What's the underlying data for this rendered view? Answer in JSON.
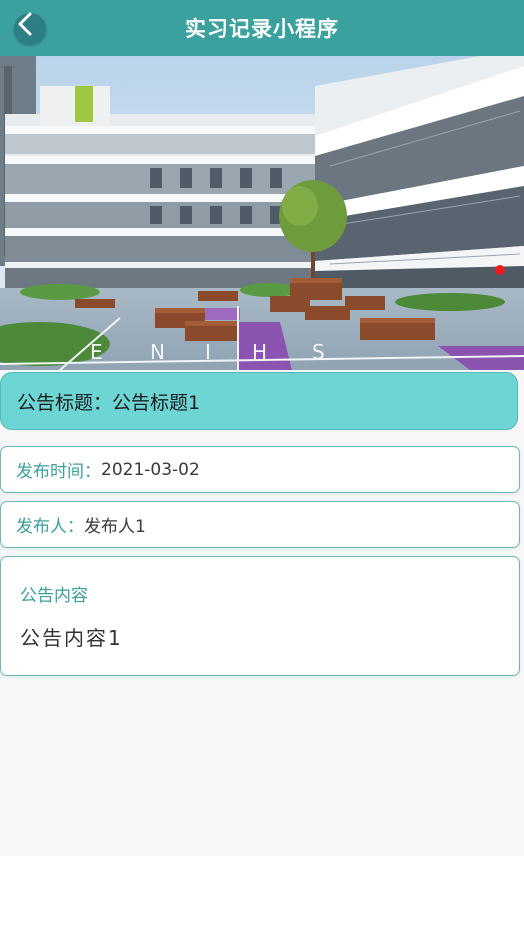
{
  "header": {
    "title": "实习记录小程序",
    "back_icon": "chevron-left-icon"
  },
  "banner": {
    "description": "school-campus-photo"
  },
  "notice": {
    "title_label": "公告标题：",
    "title_value": "公告标题1",
    "date_label": "发布时间：",
    "date_value": "2021-03-02",
    "publisher_label": "发布人：",
    "publisher_value": "发布人1",
    "content_label": "公告内容",
    "content_value": "公告内容1"
  },
  "colors": {
    "header_bg": "#3aa19f",
    "title_card_bg": "#6dd5d4",
    "label_color": "#3aa19f"
  }
}
